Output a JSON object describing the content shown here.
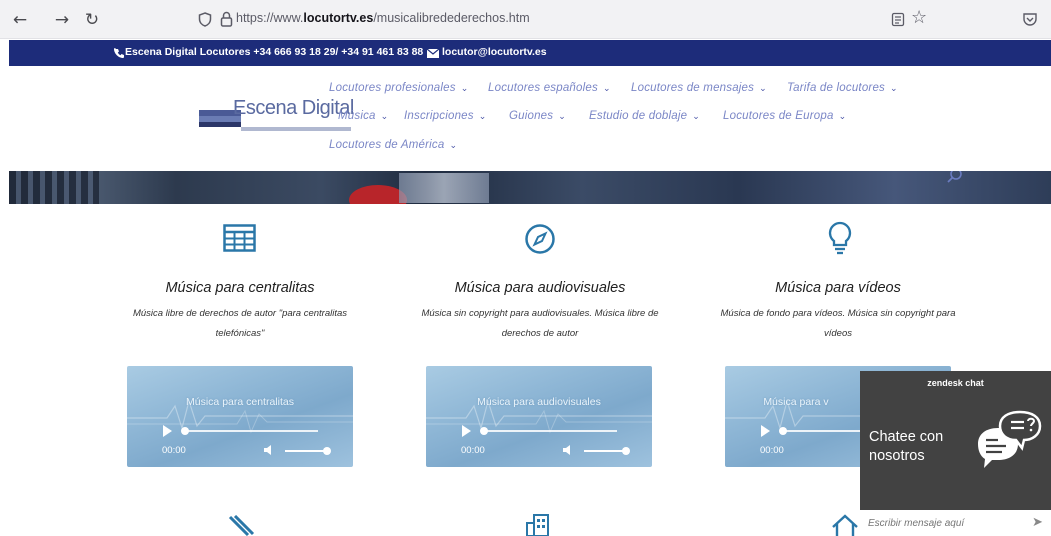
{
  "browser": {
    "url_prefix": "https://www.",
    "url_domain": "locutortv.es",
    "url_path": "/musicalibredederechos.htm"
  },
  "top_bar": {
    "phone_text": "Escena Digital Locutores +34 666 93 18 29/ +34 91 461 83 88",
    "email_text": "locutor@locutortv.es",
    "bg_color": "#1d2c7a"
  },
  "logo": {
    "text": "Escena Digital"
  },
  "menu": {
    "row1": [
      "Locutores profesionales",
      "Locutores españoles",
      "Locutores de mensajes",
      "Tarifa de locutores"
    ],
    "row2": [
      "Música",
      "Inscripciones",
      "Guiones",
      "Estudio de doblaje",
      "Locutores de Europa"
    ],
    "row3": [
      "Locutores de América"
    ]
  },
  "columns": [
    {
      "icon": "table-icon",
      "title": "Música para centralitas",
      "desc": "Música libre de derechos de autor \"para centralitas telefónicas\"",
      "player_title": "Música para centralitas",
      "time": "00:00"
    },
    {
      "icon": "compass-icon",
      "title": "Música para audiovisuales",
      "desc": "Música sin copyright para audiovisuales. Música libre de derechos de autor",
      "player_title": "Música para audiovisuales",
      "time": "00:00"
    },
    {
      "icon": "lightbulb-icon",
      "title": "Música para vídeos",
      "desc": "Música de fondo para vídeos. Música sin copyright para vídeos",
      "player_title": "Música para v",
      "time": "00:00"
    }
  ],
  "chat": {
    "header": "zendesk chat",
    "body": "Chatee con nosotros",
    "placeholder": "Escribir mensaje aquí"
  },
  "accent_color": "#2a77a8"
}
